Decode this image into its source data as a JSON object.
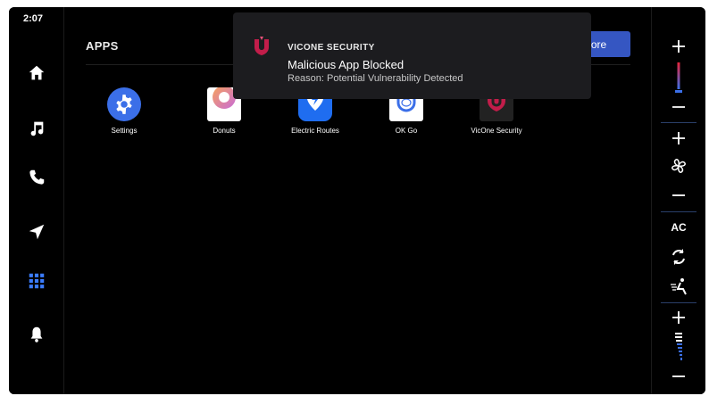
{
  "status": {
    "time": "2:07"
  },
  "header": {
    "title": "APPS",
    "store_button": "App Store"
  },
  "apps": [
    {
      "label": "Settings",
      "icon": "settings-gear-icon"
    },
    {
      "label": "Donuts",
      "icon": "donut-icon"
    },
    {
      "label": "Electric Routes",
      "icon": "electric-routes-icon"
    },
    {
      "label": "OK Go",
      "icon": "ok-go-icon"
    },
    {
      "label": "VicOne Security",
      "icon": "vicone-shield-icon"
    }
  ],
  "notification": {
    "source": "VICONE SECURITY",
    "title": "Malicious App Blocked",
    "reason": "Reason: Potential Vulnerability Detected"
  },
  "climate": {
    "ac_label": "AC"
  },
  "colors": {
    "accent": "#3556c2",
    "brand": "#c21d4a",
    "active_nav": "#3b7cff"
  }
}
